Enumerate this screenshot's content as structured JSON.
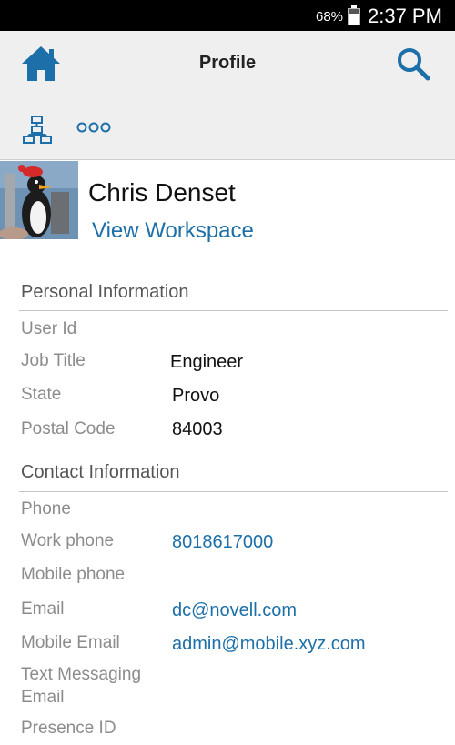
{
  "status_bar": {
    "battery": "68%",
    "battery_level": 0.68,
    "time": "2:37 PM"
  },
  "header": {
    "title": "Profile"
  },
  "profile": {
    "name": "Chris Denset",
    "workspace_link": "View Workspace"
  },
  "personal": {
    "title": "Personal Information",
    "rows": [
      {
        "label": "User Id",
        "value": ""
      },
      {
        "label": "Job Title",
        "value": "Engineer"
      },
      {
        "label": "State",
        "value": "Provo"
      },
      {
        "label": "Postal Code",
        "value": "84003"
      }
    ]
  },
  "contact": {
    "title": "Contact Information",
    "rows": [
      {
        "label": "Phone",
        "value": ""
      },
      {
        "label": "Work phone",
        "value": "8018617000"
      },
      {
        "label": "Mobile phone",
        "value": ""
      },
      {
        "label": "Email",
        "value": "dc@novell.com"
      },
      {
        "label": "Mobile Email",
        "value": "admin@mobile.xyz.com"
      },
      {
        "label": "Text Messaging Email",
        "value": ""
      },
      {
        "label": "Presence ID",
        "value": ""
      }
    ]
  },
  "colors": {
    "accent": "#1c6fa8",
    "header_bg": "#efefef"
  }
}
